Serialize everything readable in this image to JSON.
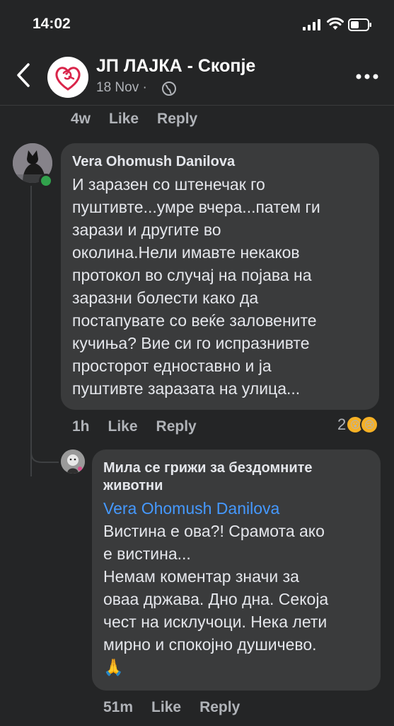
{
  "status_bar": {
    "time": "14:02"
  },
  "header": {
    "page_name": "ЈП ЛАЈКА - Скопје",
    "date": "18 Nov ·"
  },
  "top_meta": {
    "age": "4w",
    "like": "Like",
    "reply": "Reply"
  },
  "comment1": {
    "author": "Vera Ohomush Danilova",
    "lines": [
      "И заразен со штенечак го",
      "пуштивте...умре вчера...патем ги",
      "зарази и другите во",
      "околина.Нели имавте некаков",
      "протокол во случај на појава на",
      "заразни болести како да",
      "постапувате со веќе заловените",
      "кучиња? Вие си го испразнивте",
      "просторот едноставно и ја",
      "пуштивте заразата на улица..."
    ],
    "age": "1h",
    "like": "Like",
    "reply": "Reply",
    "reaction_count": "2"
  },
  "comment2": {
    "author_line1": "Мила се грижи за бездомните",
    "author_line2": "животни",
    "mention": "Vera Ohomush Danilova",
    "lines": [
      "Вистина е ова?! Срамота ако",
      "е вистина...",
      "Немам коментар значи за",
      "оваа држава. Дно дна. Секоја",
      "чест на исклучоци. Нека лети",
      "мирно и спокојно душичево.",
      "🙏"
    ],
    "age": "51m",
    "like": "Like",
    "reply": "Reply"
  }
}
